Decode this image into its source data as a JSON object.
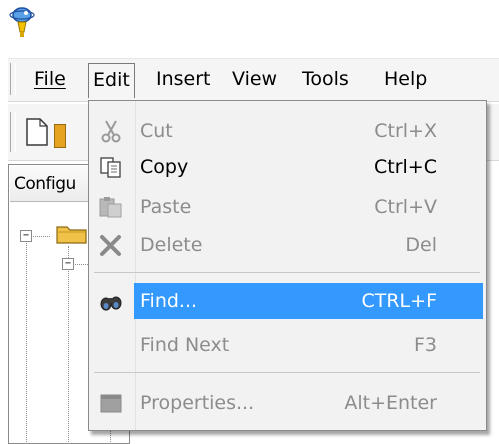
{
  "menubar": {
    "items": [
      {
        "label": "File"
      },
      {
        "label": "Edit"
      },
      {
        "label": "Insert"
      },
      {
        "label": "View"
      },
      {
        "label": "Tools"
      },
      {
        "label": "Help"
      }
    ]
  },
  "panel": {
    "header": "Configu"
  },
  "edit_menu": {
    "items": [
      {
        "label": "Cut",
        "shortcut": "Ctrl+X",
        "enabled": false,
        "icon": "scissors-icon"
      },
      {
        "label": "Copy",
        "shortcut": "Ctrl+C",
        "enabled": true,
        "icon": "copy-icon"
      },
      {
        "label": "Paste",
        "shortcut": "Ctrl+V",
        "enabled": false,
        "icon": "paste-icon"
      },
      {
        "label": "Delete",
        "shortcut": "Del",
        "enabled": false,
        "icon": "delete-icon"
      },
      {
        "label": "Find...",
        "shortcut": "CTRL+F",
        "enabled": true,
        "highlighted": true,
        "icon": "binoculars-icon"
      },
      {
        "label": "Find Next",
        "shortcut": "F3",
        "enabled": false
      },
      {
        "label": "Properties...",
        "shortcut": "Alt+Enter",
        "enabled": false,
        "icon": "properties-icon"
      }
    ]
  },
  "colors": {
    "highlight": "#3399ff",
    "menu_bg": "#f2f2f2",
    "disabled_text": "#8c8c8c"
  }
}
